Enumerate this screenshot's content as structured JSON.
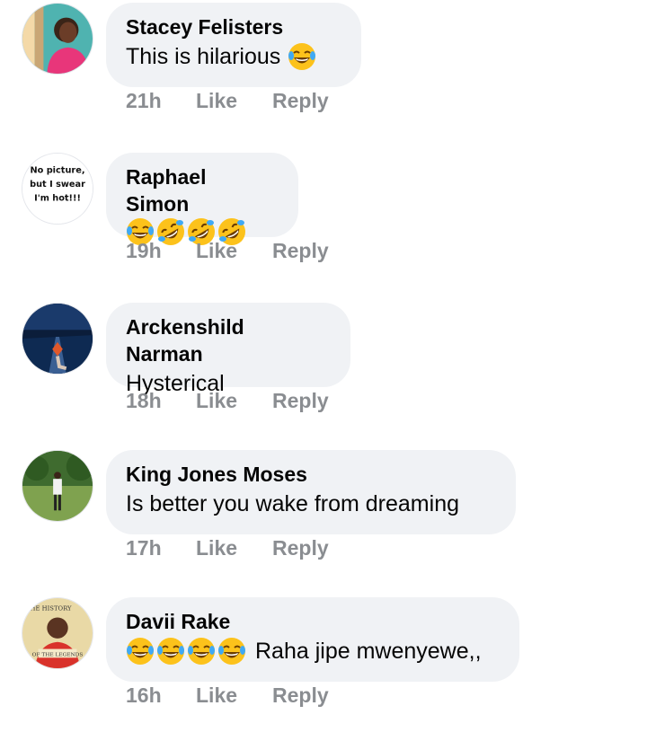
{
  "comments": [
    {
      "author": "Stacey Felisters",
      "text": "This is hilarious",
      "emojis": [
        "tears-of-joy"
      ],
      "emoji_position": "after",
      "time": "21h",
      "like_label": "Like",
      "reply_label": "Reply",
      "avatar": "photo-woman"
    },
    {
      "author": "Raphael Simon",
      "text": "",
      "emojis": [
        "tears-of-joy",
        "rolling-laughing",
        "rolling-laughing",
        "rolling-laughing"
      ],
      "emoji_position": "before",
      "time": "19h",
      "like_label": "Like",
      "reply_label": "Reply",
      "avatar": "text-avatar",
      "avatar_text": [
        "No picture,",
        "but I swear",
        "I'm hot!!!"
      ]
    },
    {
      "author": "Arckenshild Narman",
      "text": "Hysterical",
      "emojis": [],
      "emoji_position": "before",
      "time": "18h",
      "like_label": "Like",
      "reply_label": "Reply",
      "avatar": "photo-night-road"
    },
    {
      "author": "King Jones Moses",
      "text": "Is better you wake from dreaming",
      "emojis": [],
      "emoji_position": "before",
      "time": "17h",
      "like_label": "Like",
      "reply_label": "Reply",
      "avatar": "photo-man-field"
    },
    {
      "author": "Davii Rake",
      "text": "Raha jipe mwenyewe,,",
      "emojis": [
        "tears-of-joy",
        "tears-of-joy",
        "tears-of-joy",
        "tears-of-joy"
      ],
      "emoji_position": "before",
      "time": "16h",
      "like_label": "Like",
      "reply_label": "Reply",
      "avatar": "photo-legends",
      "avatar_text": [
        "THE HISTORY",
        "OF THE LEGENDS"
      ]
    }
  ],
  "colors": {
    "bubble": "#f0f2f5",
    "author": "#050505",
    "meta": "#8a8d91",
    "emoji_face": "#fcc21b",
    "emoji_tear": "#3fa9f5"
  }
}
